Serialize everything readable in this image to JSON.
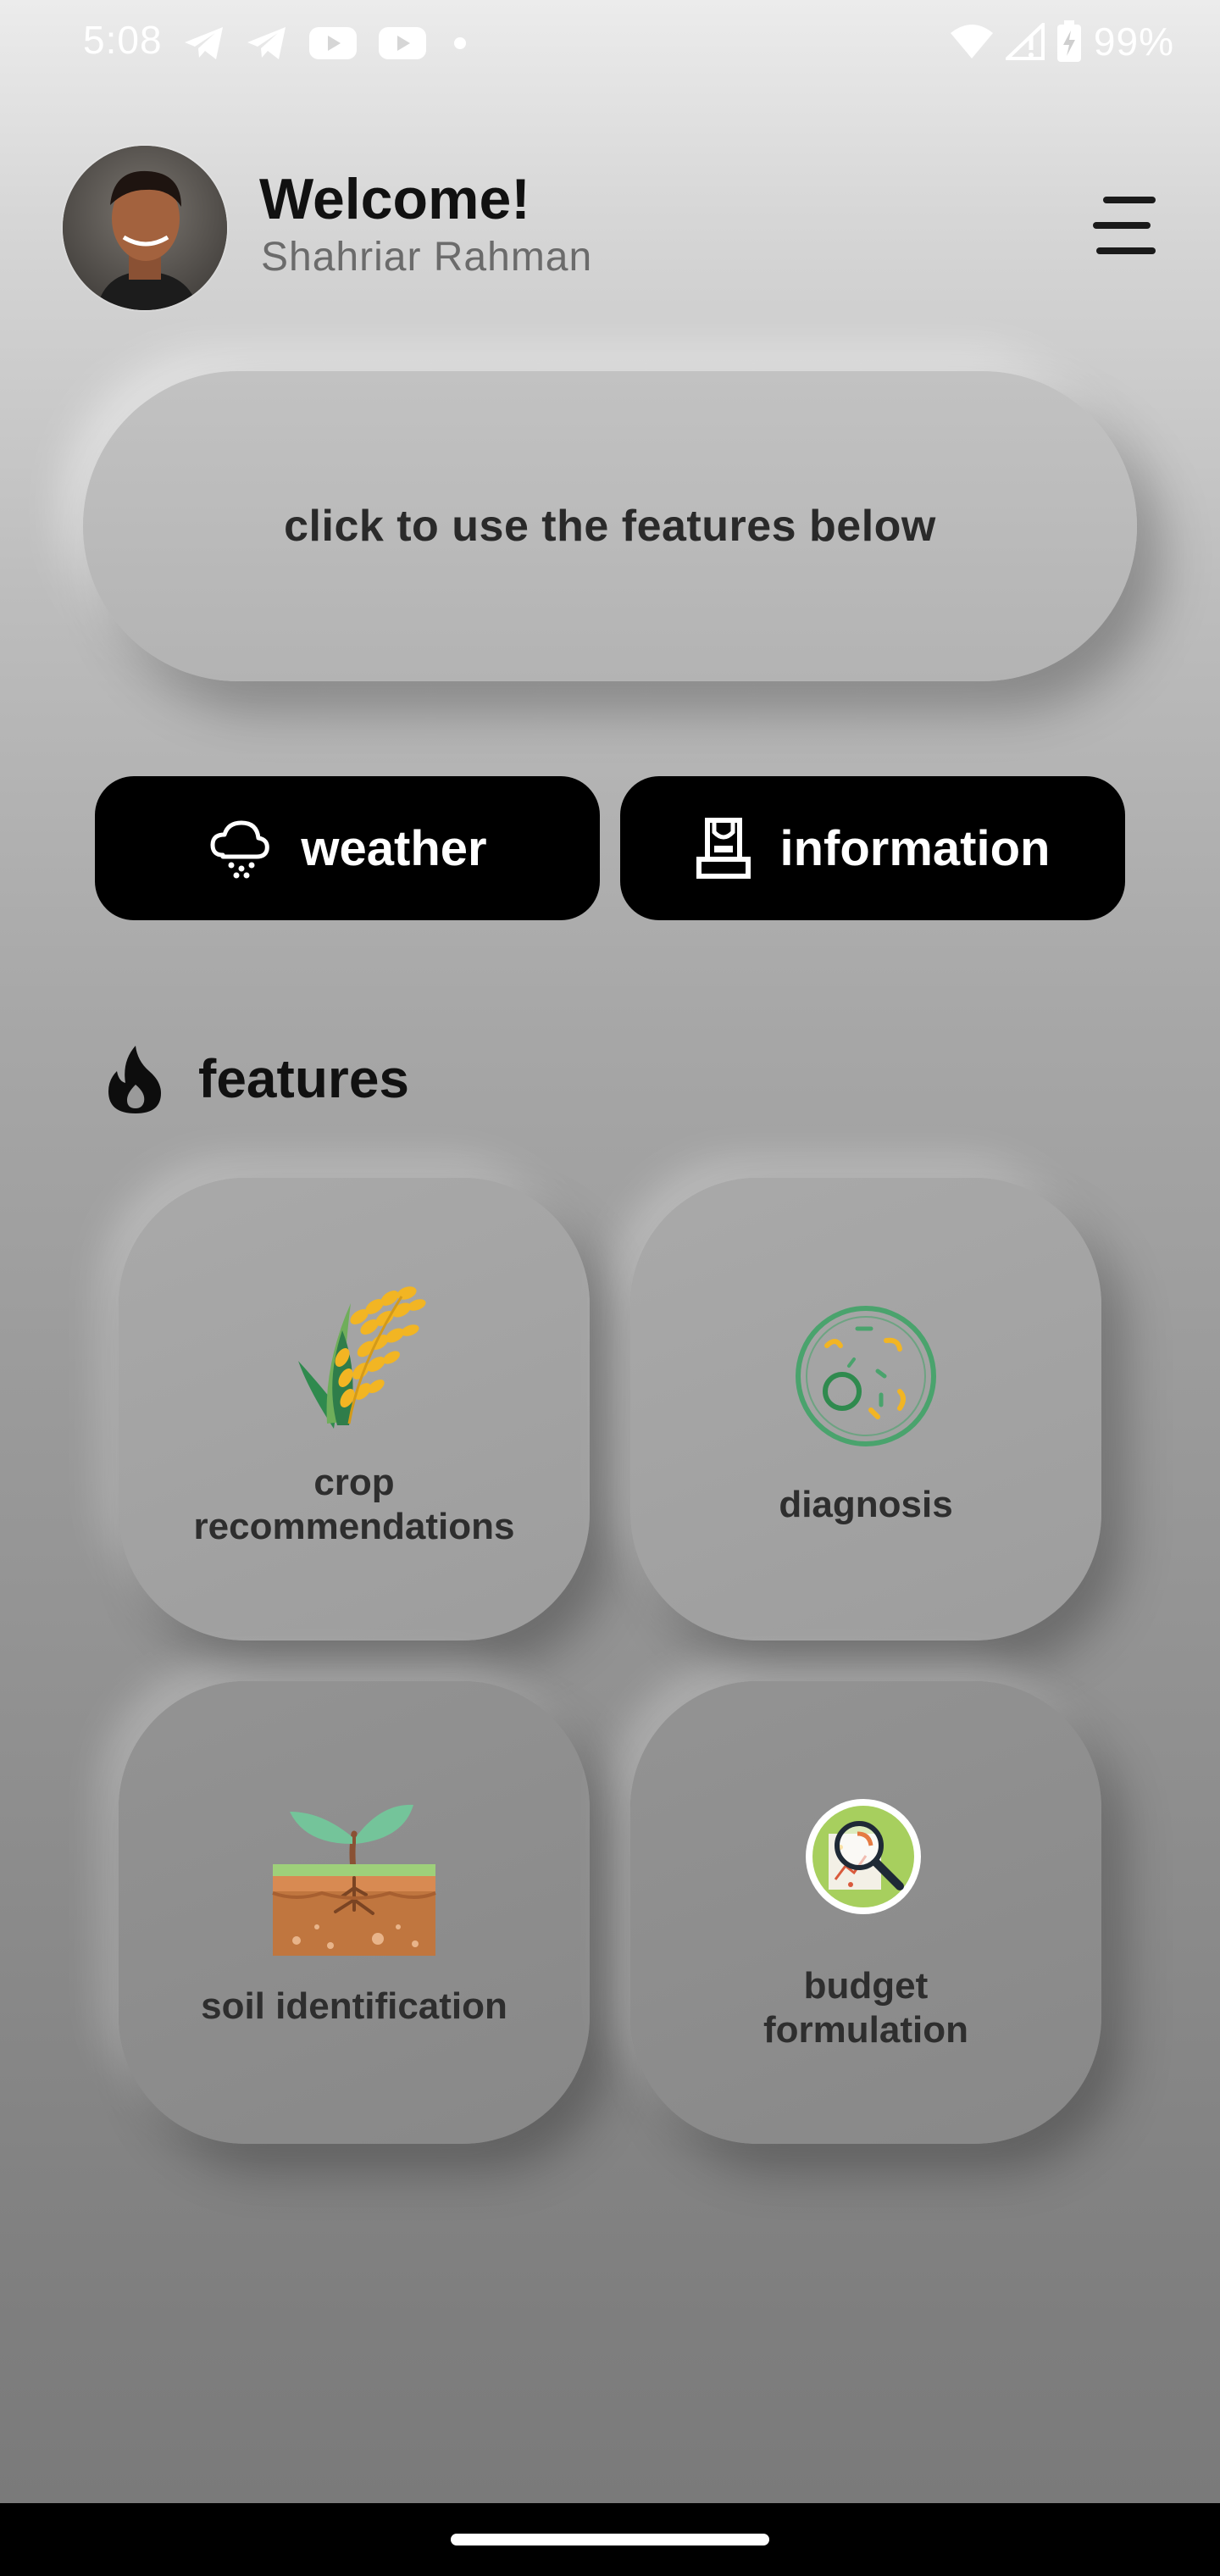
{
  "status_bar": {
    "time": "5:08",
    "notification_icons": [
      "telegram-icon",
      "telegram-icon",
      "youtube-icon",
      "youtube-icon",
      "dot-icon"
    ],
    "right_icons": [
      "wifi-icon",
      "cell-signal-icon",
      "battery-charging-icon"
    ],
    "battery": "99%"
  },
  "header": {
    "welcome": "Welcome!",
    "username": "Shahriar Rahman",
    "menu_icon": "menu-icon"
  },
  "cta": {
    "text": "click to use the features below"
  },
  "quick_actions": [
    {
      "label": "weather",
      "icon": "cloud-rain-icon"
    },
    {
      "label": "information",
      "icon": "info-device-icon"
    }
  ],
  "features": {
    "title": "features",
    "icon": "flame-icon",
    "cards": [
      {
        "label": "crop\nrecommendations",
        "icon": "wheat-icon"
      },
      {
        "label": "diagnosis",
        "icon": "petri-dish-icon"
      },
      {
        "label": "soil identification",
        "icon": "soil-sprout-icon"
      },
      {
        "label": "budget\nformulation",
        "icon": "magnifier-chart-icon"
      }
    ]
  },
  "colors": {
    "button_bg": "#000000",
    "button_text": "#ffffff",
    "wheat_yellow": "#f2b523",
    "leaf_green": "#6cc08b",
    "soil_brown": "#c0763f"
  }
}
